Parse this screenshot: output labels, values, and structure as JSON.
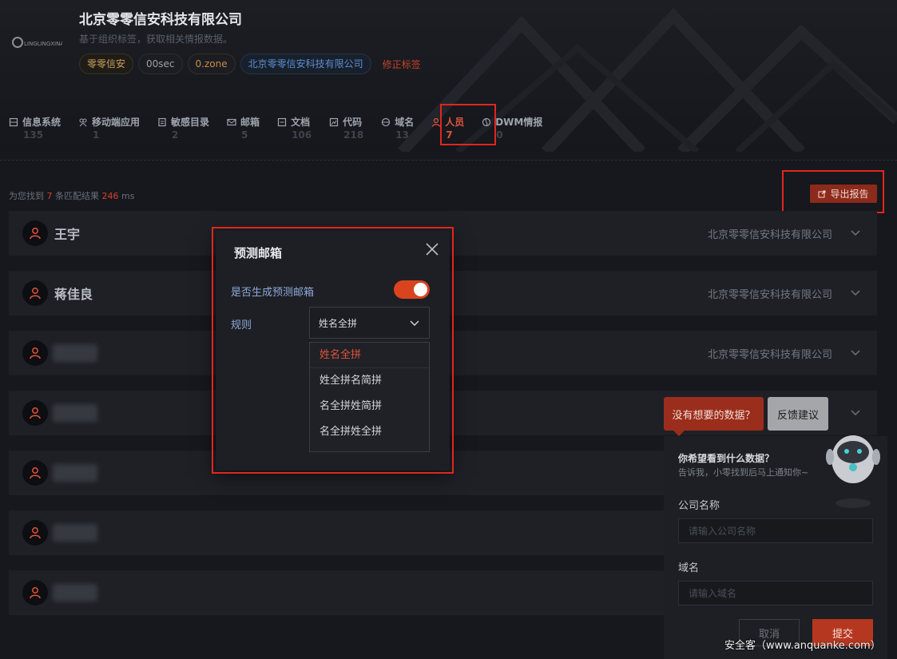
{
  "company": {
    "name": "北京零零信安科技有限公司",
    "subtitle": "基于组织标签，获取相关情报数据。",
    "logo_text": "LINGLINGXINAN",
    "tags": [
      "零零信安",
      "00sec",
      "0.zone",
      "北京零零信安科技有限公司"
    ],
    "fix_tags_label": "修正标签"
  },
  "tabs": [
    {
      "label": "信息系统",
      "count": "135",
      "icon": "server-icon"
    },
    {
      "label": "移动端应用",
      "count": "1",
      "icon": "app-icon"
    },
    {
      "label": "敏感目录",
      "count": "2",
      "icon": "folder-icon"
    },
    {
      "label": "邮箱",
      "count": "5",
      "icon": "mail-icon"
    },
    {
      "label": "文档",
      "count": "106",
      "icon": "document-icon"
    },
    {
      "label": "代码",
      "count": "218",
      "icon": "code-icon"
    },
    {
      "label": "域名",
      "count": "13",
      "icon": "domain-icon"
    },
    {
      "label": "人员",
      "count": "7",
      "icon": "person-icon",
      "active": true
    },
    {
      "label": "DWM情报",
      "count": "0",
      "icon": "dwm-icon"
    }
  ],
  "results": {
    "prefix": "为您找到",
    "count": "7",
    "middle": "条匹配结果",
    "time": "246",
    "unit": "ms",
    "export_label": "导出报告"
  },
  "people": [
    {
      "name": "王宇",
      "company": "北京零零信安科技有限公司"
    },
    {
      "name": "蒋佳良",
      "company": "北京零零信安科技有限公司"
    },
    {
      "name": "",
      "company": "北京零零信安科技有限公司"
    },
    {
      "name": "",
      "company": ""
    },
    {
      "name": "",
      "company": ""
    },
    {
      "name": "",
      "company": ""
    },
    {
      "name": "",
      "company": ""
    }
  ],
  "modal": {
    "title": "预测邮箱",
    "generate_label": "是否生成预测邮箱",
    "generate_on": true,
    "rule_label": "规则",
    "rule_selected": "姓名全拼",
    "rule_options": [
      "姓名全拼",
      "姓全拼名简拼",
      "名全拼姓简拼",
      "名全拼姓全拼"
    ]
  },
  "feedback": {
    "bubble": "没有想要的数据？",
    "button": "反馈建议",
    "question": "你希望看到什么数据？",
    "hint": "告诉我，小零找到后马上通知你~",
    "company_label": "公司名称",
    "company_placeholder": "请输入公司名称",
    "domain_label": "域名",
    "domain_placeholder": "请输入域名",
    "cancel": "取消",
    "submit": "提交"
  },
  "watermark": "安全客（www.anquanke.com）",
  "colors": {
    "accent": "#e0533b",
    "highlight_box": "#e2261d",
    "bg": "#16181d"
  }
}
